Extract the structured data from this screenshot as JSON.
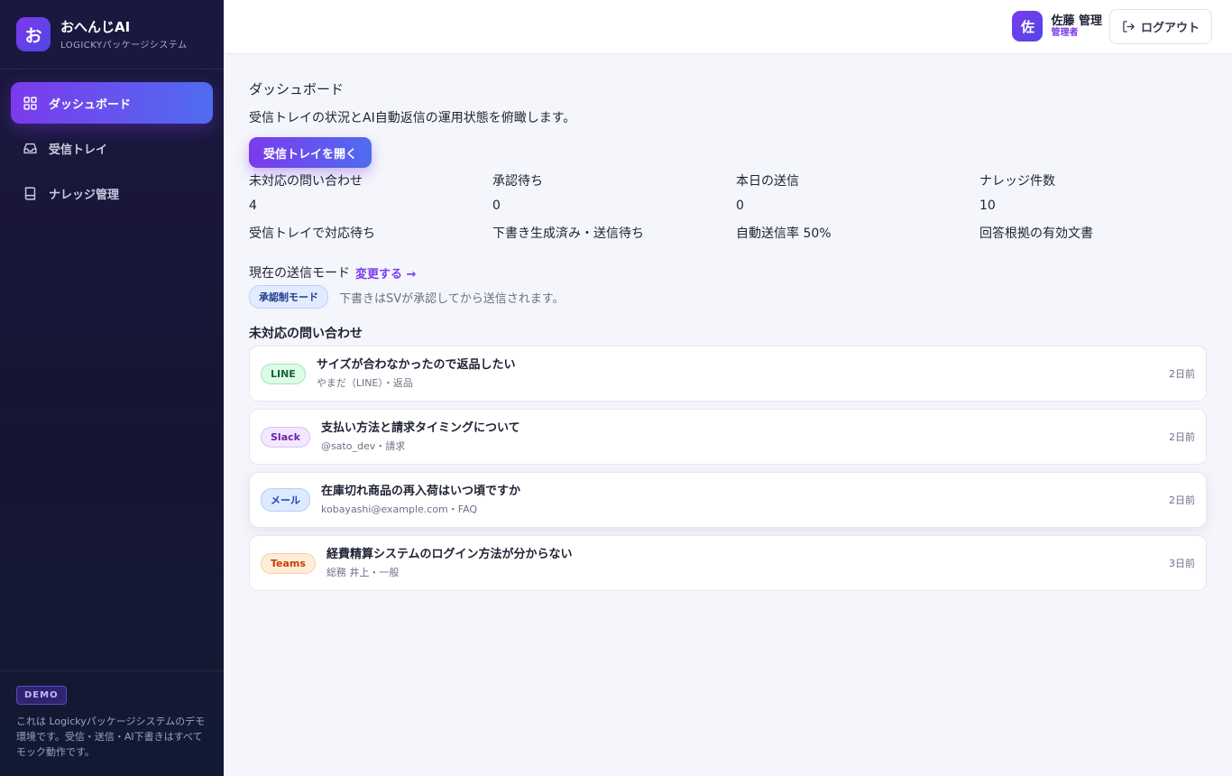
{
  "brand": {
    "logo_char": "お",
    "name": "おへんじAI",
    "subtitle": "LOGICKYパッケージシステム"
  },
  "sidebar": {
    "items": [
      {
        "label": "ダッシュボード",
        "icon": "grid-icon",
        "active": true
      },
      {
        "label": "受信トレイ",
        "icon": "inbox-icon",
        "active": false
      },
      {
        "label": "ナレッジ管理",
        "icon": "book-icon",
        "active": false
      }
    ],
    "footer": {
      "badge": "DEMO",
      "text": "これは Logickyパッケージシステムのデモ環境です。受信・送信・AI下書きはすべてモック動作です。"
    }
  },
  "header": {
    "user": {
      "avatar_char": "佐",
      "name": "佐藤 管理",
      "role": "管理者"
    },
    "logout_label": "ログアウト"
  },
  "main": {
    "title": "ダッシュボード",
    "description": "受信トレイの状況とAI自動返信の運用状態を俯瞰します。",
    "open_inbox_label": "受信トレイを開く",
    "stats": [
      {
        "label": "未対応の問い合わせ",
        "value": "4",
        "note": "受信トレイで対応待ち"
      },
      {
        "label": "承認待ち",
        "value": "0",
        "note": "下書き生成済み・送信待ち"
      },
      {
        "label": "本日の送信",
        "value": "0",
        "note": "自動送信率 50%"
      },
      {
        "label": "ナレッジ件数",
        "value": "10",
        "note": "回答根拠の有効文書"
      }
    ],
    "mode": {
      "label": "現在の送信モード",
      "change_link": "変更する →",
      "badge": "承認制モード",
      "description": "下書きはSVが承認してから送信されます。"
    },
    "list_title": "未対応の問い合わせ",
    "inquiries": [
      {
        "channel": "LINE",
        "channel_class": "line",
        "title": "サイズが合わなかったので返品したい",
        "meta": "やまだ（LINE）・返品",
        "time": "2日前"
      },
      {
        "channel": "Slack",
        "channel_class": "slack",
        "title": "支払い方法と請求タイミングについて",
        "meta": "@sato_dev・請求",
        "time": "2日前"
      },
      {
        "channel": "メール",
        "channel_class": "mail",
        "title": "在庫切れ商品の再入荷はいつ頃ですか",
        "meta": "kobayashi@example.com・FAQ",
        "time": "2日前"
      },
      {
        "channel": "Teams",
        "channel_class": "teams",
        "title": "経費精算システムのログイン方法が分からない",
        "meta": "総務 井上・一般",
        "time": "3日前"
      }
    ]
  }
}
